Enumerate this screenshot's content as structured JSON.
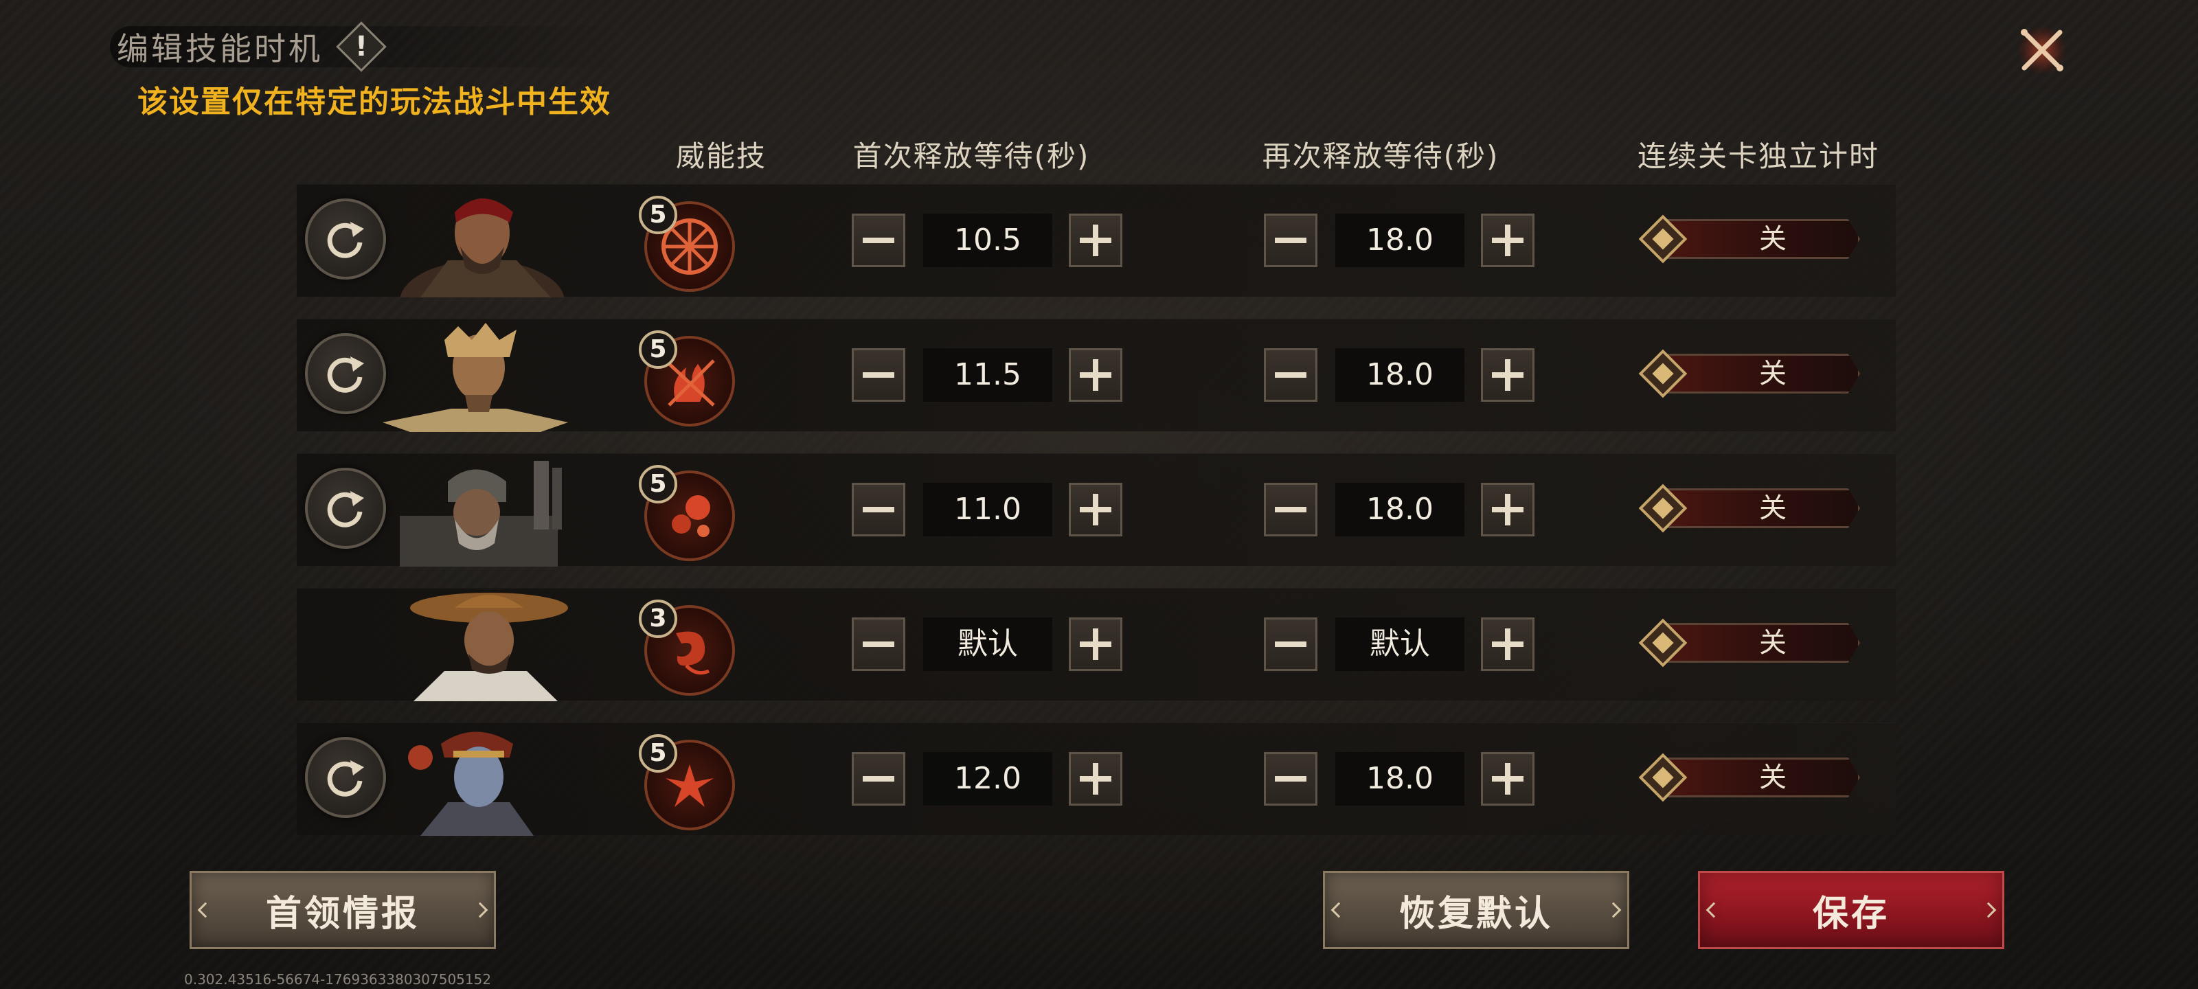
{
  "header": {
    "title": "编辑技能时机",
    "info_icon": "!",
    "subtitle": "该设置仅在特定的玩法战斗中生效"
  },
  "columns": {
    "skill": "威能技",
    "first_wait": "首次释放等待(秒)",
    "repeat_wait": "再次释放等待(秒)",
    "independent_timer": "连续关卡独立计时"
  },
  "rows": [
    {
      "skill_level": "5",
      "first_wait": "10.5",
      "repeat_wait": "18.0",
      "toggle": "关",
      "has_reset": true,
      "skill_icon": "shattered-wheel-icon"
    },
    {
      "skill_level": "5",
      "first_wait": "11.5",
      "repeat_wait": "18.0",
      "toggle": "关",
      "has_reset": true,
      "skill_icon": "flame-slash-icon"
    },
    {
      "skill_level": "5",
      "first_wait": "11.0",
      "repeat_wait": "18.0",
      "toggle": "关",
      "has_reset": true,
      "skill_icon": "fire-orbs-icon"
    },
    {
      "skill_level": "3",
      "first_wait": "默认",
      "repeat_wait": "默认",
      "toggle": "关",
      "has_reset": false,
      "skill_icon": "dragon-icon"
    },
    {
      "skill_level": "5",
      "first_wait": "12.0",
      "repeat_wait": "18.0",
      "toggle": "关",
      "has_reset": true,
      "skill_icon": "phoenix-icon"
    }
  ],
  "buttons": {
    "boss_info": "首领情报",
    "restore_default": "恢复默认",
    "save": "保存"
  },
  "version": "0.302.43516-56674-1769363380307505152",
  "colors": {
    "accent_gold": "#f0b21e",
    "save_red": "#8d1620",
    "stone": "#5a4f42"
  }
}
